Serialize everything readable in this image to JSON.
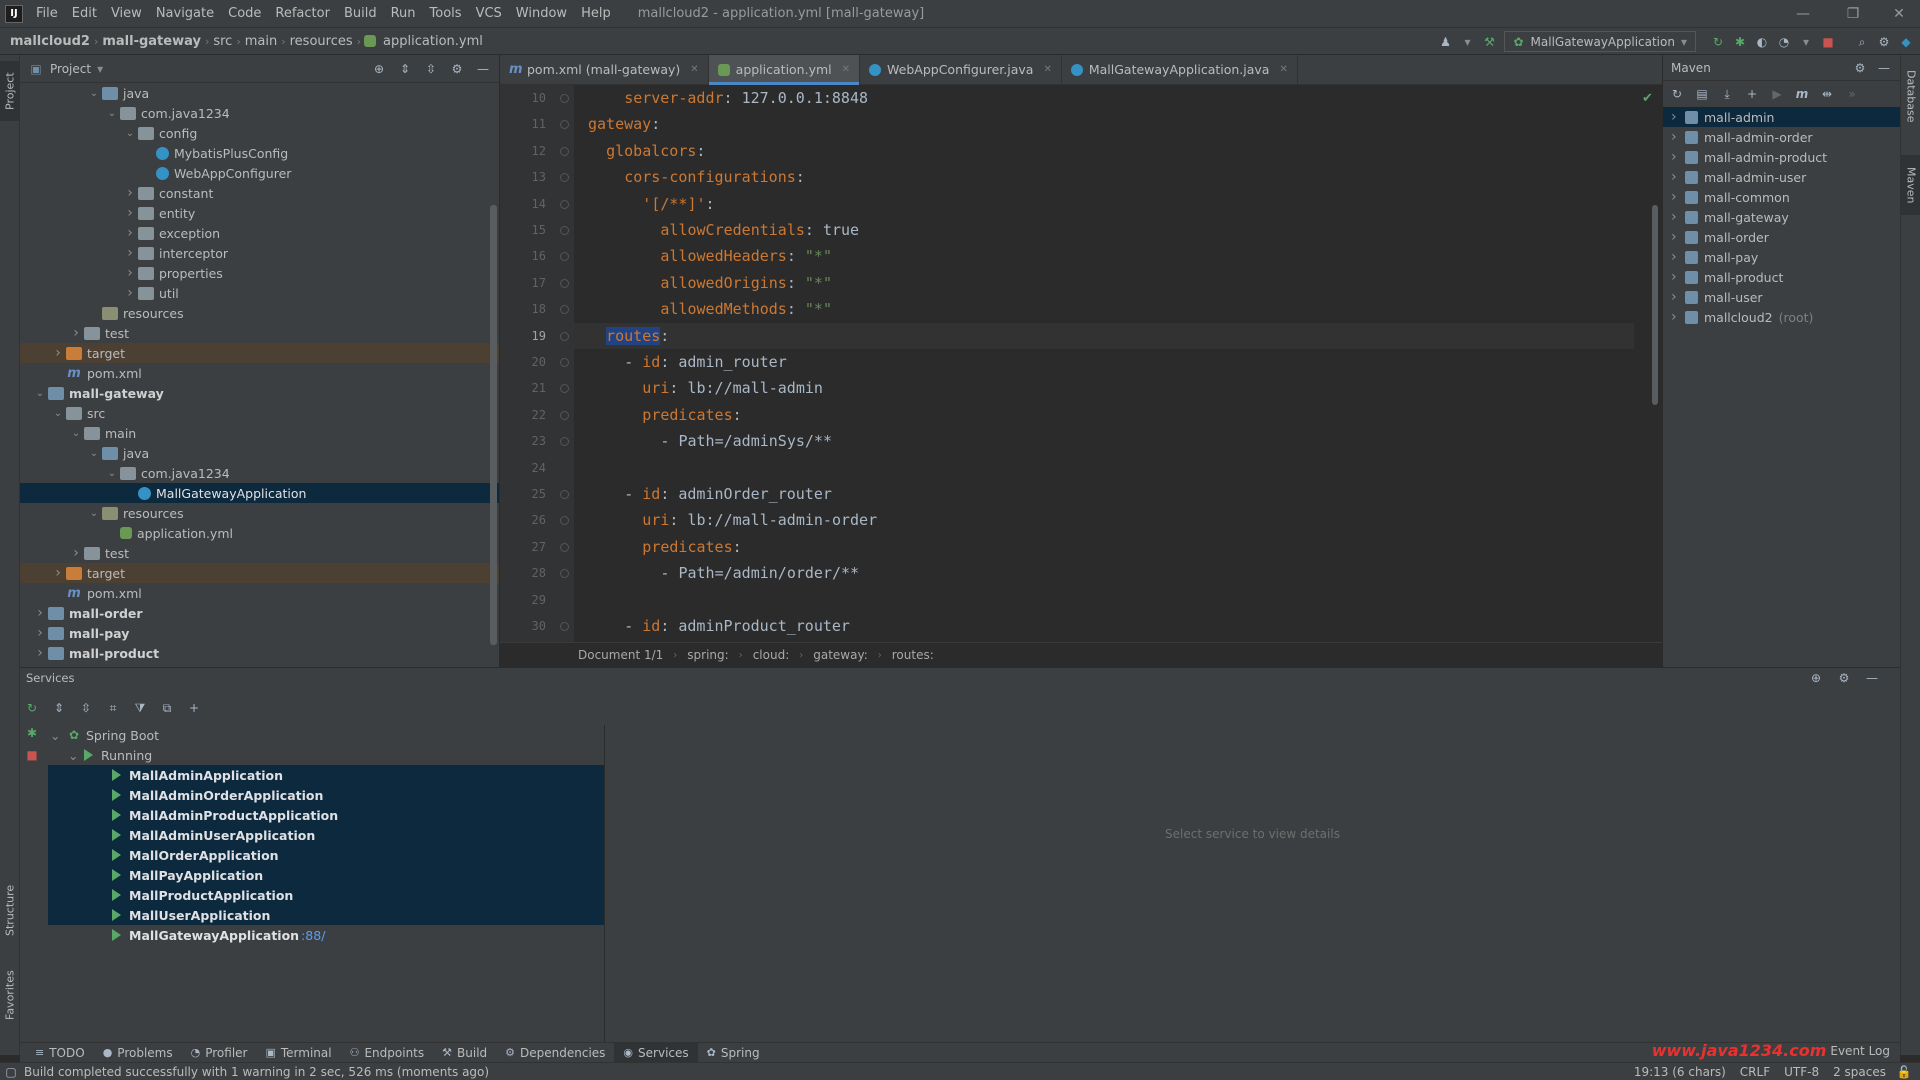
{
  "menubar": {
    "logo": "IJ",
    "items": [
      "File",
      "Edit",
      "View",
      "Navigate",
      "Code",
      "Refactor",
      "Build",
      "Run",
      "Tools",
      "VCS",
      "Window",
      "Help"
    ],
    "title": "mallcloud2 - application.yml [mall-gateway]"
  },
  "navbar": {
    "crumbs": [
      "mallcloud2",
      "mall-gateway",
      "src",
      "main",
      "resources",
      "application.yml"
    ],
    "run_config": "MallGatewayApplication"
  },
  "left_stripe": {
    "project": "Project",
    "structure": "Structure",
    "favorites": "Favorites"
  },
  "right_stripe": {
    "database": "Database",
    "maven": "Maven"
  },
  "project_panel": {
    "title": "Project",
    "items": [
      {
        "label": "java",
        "indent": 4,
        "arrow": "open",
        "icon": "src"
      },
      {
        "label": "com.java1234",
        "indent": 5,
        "arrow": "open",
        "icon": "folder"
      },
      {
        "label": "config",
        "indent": 6,
        "arrow": "open",
        "icon": "folder"
      },
      {
        "label": "MybatisPlusConfig",
        "indent": 7,
        "arrow": "",
        "icon": "class"
      },
      {
        "label": "WebAppConfigurer",
        "indent": 7,
        "arrow": "",
        "icon": "class"
      },
      {
        "label": "constant",
        "indent": 6,
        "arrow": "closed",
        "icon": "folder"
      },
      {
        "label": "entity",
        "indent": 6,
        "arrow": "closed",
        "icon": "folder"
      },
      {
        "label": "exception",
        "indent": 6,
        "arrow": "closed",
        "icon": "folder"
      },
      {
        "label": "interceptor",
        "indent": 6,
        "arrow": "closed",
        "icon": "folder"
      },
      {
        "label": "properties",
        "indent": 6,
        "arrow": "closed",
        "icon": "folder"
      },
      {
        "label": "util",
        "indent": 6,
        "arrow": "closed",
        "icon": "folder"
      },
      {
        "label": "resources",
        "indent": 4,
        "arrow": "",
        "icon": "res"
      },
      {
        "label": "test",
        "indent": 3,
        "arrow": "closed",
        "icon": "folder"
      },
      {
        "label": "target",
        "indent": 2,
        "arrow": "closed",
        "icon": "target",
        "hl": "brown"
      },
      {
        "label": "pom.xml",
        "indent": 2,
        "arrow": "",
        "icon": "mvn"
      },
      {
        "label": "mall-gateway",
        "indent": 1,
        "arrow": "open",
        "icon": "module",
        "bold": true
      },
      {
        "label": "src",
        "indent": 2,
        "arrow": "open",
        "icon": "folder"
      },
      {
        "label": "main",
        "indent": 3,
        "arrow": "open",
        "icon": "folder"
      },
      {
        "label": "java",
        "indent": 4,
        "arrow": "open",
        "icon": "src"
      },
      {
        "label": "com.java1234",
        "indent": 5,
        "arrow": "open",
        "icon": "folder"
      },
      {
        "label": "MallGatewayApplication",
        "indent": 6,
        "arrow": "",
        "icon": "class",
        "hl": "sel"
      },
      {
        "label": "resources",
        "indent": 4,
        "arrow": "open",
        "icon": "res"
      },
      {
        "label": "application.yml",
        "indent": 5,
        "arrow": "",
        "icon": "yml"
      },
      {
        "label": "test",
        "indent": 3,
        "arrow": "closed",
        "icon": "folder"
      },
      {
        "label": "target",
        "indent": 2,
        "arrow": "closed",
        "icon": "target",
        "hl": "brown"
      },
      {
        "label": "pom.xml",
        "indent": 2,
        "arrow": "",
        "icon": "mvn"
      },
      {
        "label": "mall-order",
        "indent": 1,
        "arrow": "closed",
        "icon": "module",
        "bold": true
      },
      {
        "label": "mall-pay",
        "indent": 1,
        "arrow": "closed",
        "icon": "module",
        "bold": true
      },
      {
        "label": "mall-product",
        "indent": 1,
        "arrow": "closed",
        "icon": "module",
        "bold": true
      }
    ]
  },
  "editor": {
    "tabs": [
      {
        "label": "pom.xml (mall-gateway)",
        "icon": "mvn",
        "active": false
      },
      {
        "label": "application.yml",
        "icon": "yml",
        "active": true
      },
      {
        "label": "WebAppConfigurer.java",
        "icon": "class",
        "active": false
      },
      {
        "label": "MallGatewayApplication.java",
        "icon": "class",
        "active": false
      }
    ],
    "lines": [
      {
        "n": "10",
        "indent": 2,
        "key": "server-addr",
        "sep": ": ",
        "val": "127.0.0.1:8848",
        "vt": "v"
      },
      {
        "n": "11",
        "indent": 0,
        "key": "gateway",
        "sep": ":",
        "val": "",
        "vt": "v"
      },
      {
        "n": "12",
        "indent": 1,
        "key": "globalcors",
        "sep": ":",
        "val": "",
        "vt": "v"
      },
      {
        "n": "13",
        "indent": 2,
        "key": "cors-configurations",
        "sep": ":",
        "val": "",
        "vt": "v"
      },
      {
        "n": "14",
        "indent": 3,
        "key": "'[/**]'",
        "sep": ":",
        "val": "",
        "vt": "v"
      },
      {
        "n": "15",
        "indent": 4,
        "key": "allowCredentials",
        "sep": ": ",
        "val": "true",
        "vt": "v"
      },
      {
        "n": "16",
        "indent": 4,
        "key": "allowedHeaders",
        "sep": ": ",
        "val": "\"*\"",
        "vt": "s"
      },
      {
        "n": "17",
        "indent": 4,
        "key": "allowedOrigins",
        "sep": ": ",
        "val": "\"*\"",
        "vt": "s"
      },
      {
        "n": "18",
        "indent": 4,
        "key": "allowedMethods",
        "sep": ": ",
        "val": "\"*\"",
        "vt": "s"
      },
      {
        "n": "19",
        "indent": 1,
        "key": "routes",
        "sep": ":",
        "val": "",
        "vt": "v",
        "current": true,
        "selected": true
      },
      {
        "n": "20",
        "indent": 2,
        "key": "id",
        "dash": true,
        "sep": ": ",
        "val": "admin_router",
        "vt": "v"
      },
      {
        "n": "21",
        "indent": 3,
        "key": "uri",
        "sep": ": ",
        "val": "lb://mall-admin",
        "vt": "v"
      },
      {
        "n": "22",
        "indent": 3,
        "key": "predicates",
        "sep": ":",
        "val": "",
        "vt": "v"
      },
      {
        "n": "23",
        "indent": 4,
        "key": "",
        "dash": true,
        "sep": "",
        "val": "Path=/adminSys/**",
        "vt": "v"
      },
      {
        "n": "24",
        "indent": 0,
        "key": "",
        "sep": "",
        "val": "",
        "vt": "v"
      },
      {
        "n": "25",
        "indent": 2,
        "key": "id",
        "dash": true,
        "sep": ": ",
        "val": "adminOrder_router",
        "vt": "v"
      },
      {
        "n": "26",
        "indent": 3,
        "key": "uri",
        "sep": ": ",
        "val": "lb://mall-admin-order",
        "vt": "v"
      },
      {
        "n": "27",
        "indent": 3,
        "key": "predicates",
        "sep": ":",
        "val": "",
        "vt": "v"
      },
      {
        "n": "28",
        "indent": 4,
        "key": "",
        "dash": true,
        "sep": "",
        "val": "Path=/admin/order/**",
        "vt": "v"
      },
      {
        "n": "29",
        "indent": 0,
        "key": "",
        "sep": "",
        "val": "",
        "vt": "v"
      },
      {
        "n": "30",
        "indent": 2,
        "key": "id",
        "dash": true,
        "sep": ": ",
        "val": "adminProduct_router",
        "vt": "v"
      }
    ],
    "breadcrumb": [
      "Document 1/1",
      "spring:",
      "cloud:",
      "gateway:",
      "routes:"
    ]
  },
  "maven": {
    "title": "Maven",
    "items": [
      {
        "label": "mall-admin",
        "sel": true
      },
      {
        "label": "mall-admin-order"
      },
      {
        "label": "mall-admin-product"
      },
      {
        "label": "mall-admin-user"
      },
      {
        "label": "mall-common"
      },
      {
        "label": "mall-gateway"
      },
      {
        "label": "mall-order"
      },
      {
        "label": "mall-pay"
      },
      {
        "label": "mall-product"
      },
      {
        "label": "mall-user"
      },
      {
        "label": "mallcloud2",
        "root": "(root)"
      }
    ]
  },
  "services": {
    "title": "Services",
    "spring_boot": "Spring Boot",
    "running": "Running",
    "apps": [
      {
        "label": "MallAdminApplication",
        "sel": true,
        "port": ""
      },
      {
        "label": "MallAdminOrderApplication",
        "sel": true,
        "port": ""
      },
      {
        "label": "MallAdminProductApplication",
        "sel": true,
        "port": ""
      },
      {
        "label": "MallAdminUserApplication",
        "sel": true,
        "port": ""
      },
      {
        "label": "MallOrderApplication",
        "sel": true,
        "port": ""
      },
      {
        "label": "MallPayApplication",
        "sel": true,
        "port": ""
      },
      {
        "label": "MallProductApplication",
        "sel": true,
        "port": ""
      },
      {
        "label": "MallUserApplication",
        "sel": true,
        "port": ""
      },
      {
        "label": "MallGatewayApplication",
        "sel": false,
        "port": ":88/"
      }
    ],
    "placeholder": "Select service to view details"
  },
  "tool_tabs": [
    {
      "label": "TODO",
      "icon": "≡",
      "active": false
    },
    {
      "label": "Problems",
      "icon": "●",
      "active": false
    },
    {
      "label": "Profiler",
      "icon": "◔",
      "active": false
    },
    {
      "label": "Terminal",
      "icon": "▣",
      "active": false
    },
    {
      "label": "Endpoints",
      "icon": "⚇",
      "active": false
    },
    {
      "label": "Build",
      "icon": "⚒",
      "active": false
    },
    {
      "label": "Dependencies",
      "icon": "⚙",
      "active": false
    },
    {
      "label": "Services",
      "icon": "◉",
      "active": true
    },
    {
      "label": "Spring",
      "icon": "✿",
      "active": false
    }
  ],
  "status": {
    "message": "Build completed successfully with 1 warning in 2 sec, 526 ms (moments ago)",
    "position": "19:13 (6 chars)",
    "line_sep": "CRLF",
    "encoding": "UTF-8",
    "indent": "2 spaces",
    "event_log": "Event Log",
    "watermark": "www.java1234.com"
  }
}
